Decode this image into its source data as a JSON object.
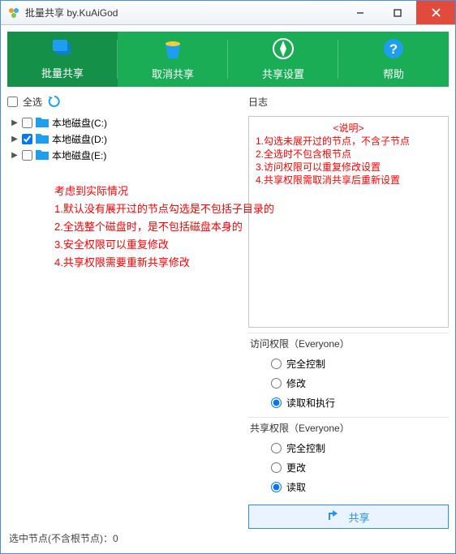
{
  "window": {
    "title": "批量共享 by.KuAiGod"
  },
  "tabs": [
    {
      "label": "批量共享"
    },
    {
      "label": "取消共享"
    },
    {
      "label": "共享设置"
    },
    {
      "label": "帮助"
    }
  ],
  "toolbar": {
    "select_all_label": "全选"
  },
  "tree": {
    "items": [
      {
        "label": "本地磁盘(C:)",
        "checked": false
      },
      {
        "label": "本地磁盘(D:)",
        "checked": true
      },
      {
        "label": "本地磁盘(E:)",
        "checked": false
      }
    ]
  },
  "left_notes": {
    "heading": "考虑到实际情况",
    "line1": "1.默认没有展开过的节点勾选是不包括子目录的",
    "line2": "2.全选整个磁盘时，是不包括磁盘本身的",
    "line3": "3.安全权限可以重复修改",
    "line4": "4.共享权限需要重新共享修改"
  },
  "log": {
    "section_label": "日志",
    "title": "<说明>",
    "line1": "1.勾选未展开过的节点，不含子节点",
    "line2": "2.全选时不包含根节点",
    "line3": "3.访问权限可以重复修改设置",
    "line4": "4.共享权限需取消共享后重新设置"
  },
  "access_perm": {
    "title": "访问权限（Everyone）",
    "options": [
      {
        "label": "完全控制",
        "selected": false
      },
      {
        "label": "修改",
        "selected": false
      },
      {
        "label": "读取和执行",
        "selected": true
      }
    ]
  },
  "share_perm": {
    "title": "共享权限（Everyone）",
    "options": [
      {
        "label": "完全控制",
        "selected": false
      },
      {
        "label": "更改",
        "selected": false
      },
      {
        "label": "读取",
        "selected": true
      }
    ]
  },
  "share_button": {
    "label": "共享"
  },
  "status_bar": {
    "text": "选中节点(不含根节点)：0"
  },
  "colors": {
    "tab_bg": "#1aad56",
    "tab_active": "#149048",
    "accent_blue": "#2b90e8",
    "note_red": "#f00",
    "close_red": "#e04b3b"
  }
}
